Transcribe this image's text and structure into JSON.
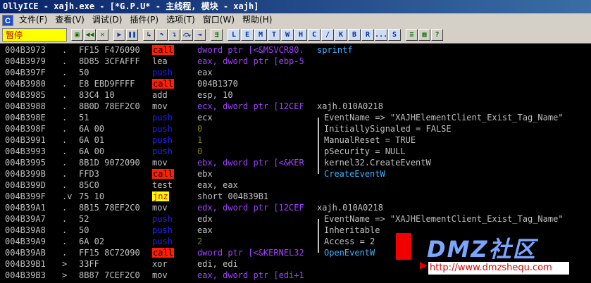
{
  "window": {
    "title": "OllyICE - xajh.exe - [*G.P.U* -  主线程, 模块 - xajh]"
  },
  "menu": {
    "app_icon": "C",
    "items": [
      "文件(F)",
      "查看(V)",
      "调试(D)",
      "插件(P)",
      "选项(T)",
      "窗口(W)",
      "帮助(H)"
    ]
  },
  "toolbar": {
    "status": "暂停",
    "group1": [
      {
        "label": "◀◀",
        "icon": "rewind-icon"
      },
      {
        "label": "✕",
        "icon": "close-icon"
      }
    ],
    "open_icon": "open-icon",
    "group2": [
      {
        "label": "▶",
        "icon": "run-icon"
      },
      {
        "label": "❚❚",
        "icon": "pause-icon"
      }
    ],
    "group3": [
      {
        "label": "↳",
        "icon": "step-into-icon"
      },
      {
        "label": "↷",
        "icon": "step-over-icon"
      },
      {
        "label": "↴",
        "icon": "trace-into-icon"
      },
      {
        "label": "⤼",
        "icon": "trace-over-icon"
      },
      {
        "label": "⇥",
        "icon": "execute-till-return-icon"
      }
    ],
    "goto_icon": "goto-icon",
    "letters": [
      "L",
      "E",
      "M",
      "T",
      "W",
      "H",
      "C",
      "/",
      "K",
      "B",
      "R",
      "...",
      "S"
    ],
    "group5": [
      {
        "label": "≡",
        "icon": "list-icon"
      },
      {
        "label": "▦",
        "icon": "grid-icon"
      },
      {
        "label": "?",
        "icon": "help-icon"
      }
    ]
  },
  "disasm": [
    {
      "addr": "004B3973",
      "mark": ".",
      "hex": "FF15 F476090",
      "mnemonic": "call",
      "operands": "dword ptr [<&MSVCR80.",
      "comment": "sprintf"
    },
    {
      "addr": "004B3979",
      "mark": ".",
      "hex": "8D85 3CFAFFF",
      "mnemonic": "lea",
      "operands": "eax, dword ptr [ebp-5",
      "comment": ""
    },
    {
      "addr": "004B397F",
      "mark": ".",
      "hex": "50",
      "mnemonic": "push",
      "operands": "eax",
      "comment": ""
    },
    {
      "addr": "004B3980",
      "mark": ".",
      "hex": "E8 EBD9FFFF",
      "mnemonic": "call",
      "operands": "004B1370",
      "comment": ""
    },
    {
      "addr": "004B3985",
      "mark": ".",
      "hex": "83C4 10",
      "mnemonic": "add",
      "operands": "esp, 10",
      "comment": ""
    },
    {
      "addr": "004B3988",
      "mark": ".",
      "hex": "8B0D 78EF2C0",
      "mnemonic": "mov",
      "operands": "ecx, dword ptr [12CEF",
      "comment": "xajh.010A0218"
    },
    {
      "addr": "004B398E",
      "mark": ".",
      "hex": "51",
      "mnemonic": "push",
      "operands": "ecx",
      "comment": "EventName => \"XAJHElementClient_Exist_Tag_Name\""
    },
    {
      "addr": "004B398F",
      "mark": ".",
      "hex": "6A 00",
      "mnemonic": "push",
      "operands": "0",
      "comment": "InitiallySignaled = FALSE"
    },
    {
      "addr": "004B3991",
      "mark": ".",
      "hex": "6A 01",
      "mnemonic": "push",
      "operands": "1",
      "comment": "ManualReset = TRUE"
    },
    {
      "addr": "004B3993",
      "mark": ".",
      "hex": "6A 00",
      "mnemonic": "push",
      "operands": "0",
      "comment": "pSecurity = NULL"
    },
    {
      "addr": "004B3995",
      "mark": ".",
      "hex": "8B1D 9072090",
      "mnemonic": "mov",
      "operands": "ebx, dword ptr [<&KER",
      "comment": "kernel32.CreateEventW"
    },
    {
      "addr": "004B399B",
      "mark": ".",
      "hex": "FFD3",
      "mnemonic": "call",
      "operands": "ebx",
      "comment": "CreateEventW"
    },
    {
      "addr": "004B399D",
      "mark": ".",
      "hex": "85C0",
      "mnemonic": "test",
      "operands": "eax, eax",
      "comment": ""
    },
    {
      "addr": "004B399F",
      "mark": ".v",
      "hex": "75 10",
      "mnemonic": "jnz",
      "operands": "short 004B39B1",
      "comment": ""
    },
    {
      "addr": "004B39A1",
      "mark": ".",
      "hex": "8B15 78EF2C0",
      "mnemonic": "mov",
      "operands": "edx, dword ptr [12CEF",
      "comment": "xajh.010A0218"
    },
    {
      "addr": "004B39A7",
      "mark": ".",
      "hex": "52",
      "mnemonic": "push",
      "operands": "edx",
      "comment": "EventName => \"XAJHElementClient_Exist_Tag_Name\""
    },
    {
      "addr": "004B39A8",
      "mark": ".",
      "hex": "50",
      "mnemonic": "push",
      "operands": "eax",
      "comment": "Inheritable"
    },
    {
      "addr": "004B39A9",
      "mark": ".",
      "hex": "6A 02",
      "mnemonic": "push",
      "operands": "2",
      "comment": "Access = 2"
    },
    {
      "addr": "004B39AB",
      "mark": ".",
      "hex": "FF15 8C72090",
      "mnemonic": "call",
      "operands": "dword ptr [<&KERNEL32",
      "comment": "OpenEventW"
    },
    {
      "addr": "004B39B1",
      "mark": ">",
      "hex": "33FF",
      "mnemonic": "xor",
      "operands": "edi, edi",
      "comment": ""
    },
    {
      "addr": "004B39B3",
      "mark": ">",
      "hex": "8B87 7CEF2C0",
      "mnemonic": "mov",
      "operands": "eax, dword ptr [edi+1",
      "comment": ""
    }
  ],
  "watermark": {
    "logo": "DMZ社区",
    "url": "http://www.dmzshequ.com"
  },
  "colors": {
    "call_bg": "#ff2000",
    "jnz_bg": "#ffff00",
    "push_fg": "#2020ff",
    "api_comment": "#40b0ff"
  }
}
